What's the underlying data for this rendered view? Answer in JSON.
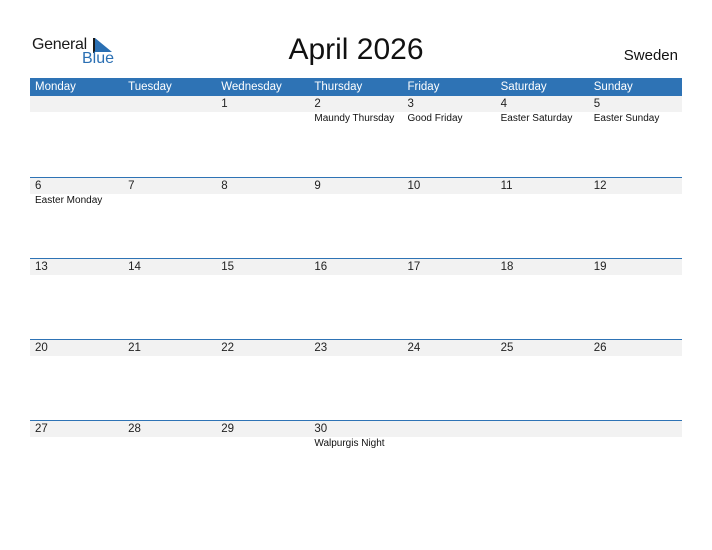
{
  "logo": {
    "line1": "General",
    "line2": "Blue"
  },
  "title": "April 2026",
  "country": "Sweden",
  "colors": {
    "accent": "#2e73b5",
    "day_row_bg": "#f2f2f2"
  },
  "weekdays": [
    "Monday",
    "Tuesday",
    "Wednesday",
    "Thursday",
    "Friday",
    "Saturday",
    "Sunday"
  ],
  "weeks": [
    {
      "days": [
        "",
        "",
        "1",
        "2",
        "3",
        "4",
        "5"
      ],
      "holidays": [
        "",
        "",
        "",
        "Maundy Thursday",
        "Good Friday",
        "Easter Saturday",
        "Easter Sunday"
      ]
    },
    {
      "days": [
        "6",
        "7",
        "8",
        "9",
        "10",
        "11",
        "12"
      ],
      "holidays": [
        "Easter Monday",
        "",
        "",
        "",
        "",
        "",
        ""
      ]
    },
    {
      "days": [
        "13",
        "14",
        "15",
        "16",
        "17",
        "18",
        "19"
      ],
      "holidays": [
        "",
        "",
        "",
        "",
        "",
        "",
        ""
      ]
    },
    {
      "days": [
        "20",
        "21",
        "22",
        "23",
        "24",
        "25",
        "26"
      ],
      "holidays": [
        "",
        "",
        "",
        "",
        "",
        "",
        ""
      ]
    },
    {
      "days": [
        "27",
        "28",
        "29",
        "30",
        "",
        "",
        ""
      ],
      "holidays": [
        "",
        "",
        "",
        "Walpurgis Night",
        "",
        "",
        ""
      ]
    }
  ]
}
